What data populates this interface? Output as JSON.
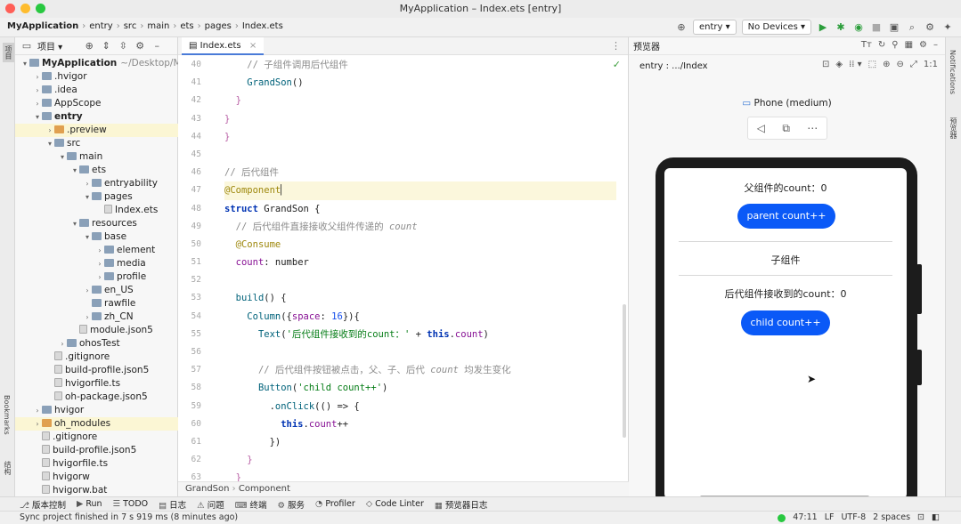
{
  "window": {
    "title": "MyApplication – Index.ets [entry]"
  },
  "breadcrumb": [
    "MyApplication",
    "entry",
    "src",
    "main",
    "ets",
    "pages",
    "Index.ets"
  ],
  "toolbar": {
    "module_dropdown": "entry",
    "device_dropdown": "No Devices"
  },
  "left_strip": {
    "project_label": "项目",
    "bookmarks_label": "Bookmarks",
    "structure_label": "结构"
  },
  "right_strip": {
    "notifications_label": "Notifications",
    "previewer_label": "预览器"
  },
  "project": {
    "title": "项目",
    "tree": [
      {
        "label": "MyApplication",
        "extra": "~/Desktop/My...",
        "indent": 0,
        "arrow": "▾",
        "kind": "folder",
        "bold": true
      },
      {
        "label": ".hvigor",
        "indent": 1,
        "arrow": "›",
        "kind": "folder"
      },
      {
        "label": ".idea",
        "indent": 1,
        "arrow": "›",
        "kind": "folder"
      },
      {
        "label": "AppScope",
        "indent": 1,
        "arrow": "›",
        "kind": "folder"
      },
      {
        "label": "entry",
        "indent": 1,
        "arrow": "▾",
        "kind": "folder",
        "bold": true
      },
      {
        "label": ".preview",
        "indent": 2,
        "arrow": "›",
        "kind": "folder-o",
        "hl": true
      },
      {
        "label": "src",
        "indent": 2,
        "arrow": "▾",
        "kind": "folder"
      },
      {
        "label": "main",
        "indent": 3,
        "arrow": "▾",
        "kind": "folder"
      },
      {
        "label": "ets",
        "indent": 4,
        "arrow": "▾",
        "kind": "folder"
      },
      {
        "label": "entryability",
        "indent": 5,
        "arrow": "›",
        "kind": "folder"
      },
      {
        "label": "pages",
        "indent": 5,
        "arrow": "▾",
        "kind": "folder"
      },
      {
        "label": "Index.ets",
        "indent": 6,
        "arrow": "",
        "kind": "file"
      },
      {
        "label": "resources",
        "indent": 4,
        "arrow": "▾",
        "kind": "folder"
      },
      {
        "label": "base",
        "indent": 5,
        "arrow": "▾",
        "kind": "folder"
      },
      {
        "label": "element",
        "indent": 6,
        "arrow": "›",
        "kind": "folder"
      },
      {
        "label": "media",
        "indent": 6,
        "arrow": "›",
        "kind": "folder"
      },
      {
        "label": "profile",
        "indent": 6,
        "arrow": "›",
        "kind": "folder"
      },
      {
        "label": "en_US",
        "indent": 5,
        "arrow": "›",
        "kind": "folder"
      },
      {
        "label": "rawfile",
        "indent": 5,
        "arrow": "",
        "kind": "folder"
      },
      {
        "label": "zh_CN",
        "indent": 5,
        "arrow": "›",
        "kind": "folder"
      },
      {
        "label": "module.json5",
        "indent": 4,
        "arrow": "",
        "kind": "file"
      },
      {
        "label": "ohosTest",
        "indent": 3,
        "arrow": "›",
        "kind": "folder"
      },
      {
        "label": ".gitignore",
        "indent": 2,
        "arrow": "",
        "kind": "file"
      },
      {
        "label": "build-profile.json5",
        "indent": 2,
        "arrow": "",
        "kind": "file"
      },
      {
        "label": "hvigorfile.ts",
        "indent": 2,
        "arrow": "",
        "kind": "file"
      },
      {
        "label": "oh-package.json5",
        "indent": 2,
        "arrow": "",
        "kind": "file"
      },
      {
        "label": "hvigor",
        "indent": 1,
        "arrow": "›",
        "kind": "folder"
      },
      {
        "label": "oh_modules",
        "indent": 1,
        "arrow": "›",
        "kind": "folder-o",
        "hl": true
      },
      {
        "label": ".gitignore",
        "indent": 1,
        "arrow": "",
        "kind": "file"
      },
      {
        "label": "build-profile.json5",
        "indent": 1,
        "arrow": "",
        "kind": "file"
      },
      {
        "label": "hvigorfile.ts",
        "indent": 1,
        "arrow": "",
        "kind": "file"
      },
      {
        "label": "hvigorw",
        "indent": 1,
        "arrow": "",
        "kind": "file"
      },
      {
        "label": "hvigorw.bat",
        "indent": 1,
        "arrow": "",
        "kind": "file"
      }
    ]
  },
  "editor": {
    "tab": "Index.ets",
    "line_numbers": [
      "40",
      "41",
      "42",
      "43",
      "44",
      "45",
      "46",
      "47",
      "48",
      "49",
      "50",
      "51",
      "52",
      "53",
      "54",
      "55",
      "56",
      "57",
      "58",
      "59",
      "60",
      "61",
      "62",
      "63"
    ],
    "breadcrumb": [
      "GrandSon",
      "Component"
    ]
  },
  "preview": {
    "title": "预览器",
    "path": "entry : .../Index",
    "device": "Phone (medium)",
    "parent_text": "父组件的count：0",
    "parent_button": "parent count++",
    "child_label": "子组件",
    "grandson_text": "后代组件接收到的count：0",
    "child_button": "child count++"
  },
  "bottom_tools": [
    "版本控制",
    "Run",
    "TODO",
    "日志",
    "问题",
    "终端",
    "服务",
    "Profiler",
    "Code Linter",
    "预览器日志"
  ],
  "status": {
    "message": "Sync project finished in 7 s 919 ms (8 minutes ago)",
    "position": "47:11",
    "line_sep": "LF",
    "encoding": "UTF-8",
    "indent": "2 spaces"
  },
  "colors": {
    "accent": "#0a59f7",
    "traffic_red": "#ff5f57",
    "traffic_yellow": "#febc2e",
    "traffic_green": "#28c840"
  }
}
